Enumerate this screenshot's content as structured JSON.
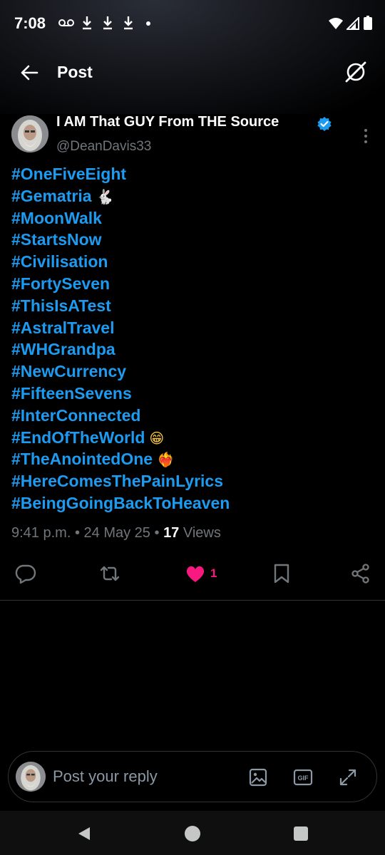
{
  "status_bar": {
    "time": "7:08",
    "icons": [
      "voicemail-icon",
      "download-icon",
      "download-icon",
      "download-icon",
      "dot-icon",
      "wifi-icon",
      "signal-icon",
      "battery-icon"
    ]
  },
  "header": {
    "title": "Post"
  },
  "author": {
    "name": "I AM That GUY From THE Source",
    "handle": "@DeanDavis33",
    "verified": true
  },
  "post": {
    "hashtags": [
      {
        "text": "#OneFiveEight",
        "emoji": ""
      },
      {
        "text": "#Gematria",
        "emoji": "🐇"
      },
      {
        "text": "#MoonWalk",
        "emoji": ""
      },
      {
        "text": "#StartsNow",
        "emoji": ""
      },
      {
        "text": "#Civilisation",
        "emoji": ""
      },
      {
        "text": "#FortySeven",
        "emoji": ""
      },
      {
        "text": "#ThisIsATest",
        "emoji": ""
      },
      {
        "text": "#AstralTravel",
        "emoji": ""
      },
      {
        "text": "#WHGrandpa",
        "emoji": ""
      },
      {
        "text": "#NewCurrency",
        "emoji": ""
      },
      {
        "text": "#FifteenSevens",
        "emoji": ""
      },
      {
        "text": "#InterConnected",
        "emoji": ""
      },
      {
        "text": "#EndOfTheWorld",
        "emoji": "😁"
      },
      {
        "text": "#TheAnointedOne",
        "emoji": "❤️‍🔥"
      },
      {
        "text": "#HereComesThePainLyrics",
        "emoji": ""
      },
      {
        "text": "#BeingGoingBackToHeaven",
        "emoji": ""
      }
    ]
  },
  "meta": {
    "time": "9:41 p.m.",
    "separator": "•",
    "date": "24 May 25",
    "views_count": "17",
    "views_label": "Views"
  },
  "actions": {
    "like_count": "1",
    "liked": true
  },
  "reply": {
    "placeholder": "Post your reply",
    "gif_label": "GIF"
  },
  "colors": {
    "accent": "#1d9bf0",
    "like": "#f91880",
    "muted": "#71767b",
    "background": "#000000"
  }
}
